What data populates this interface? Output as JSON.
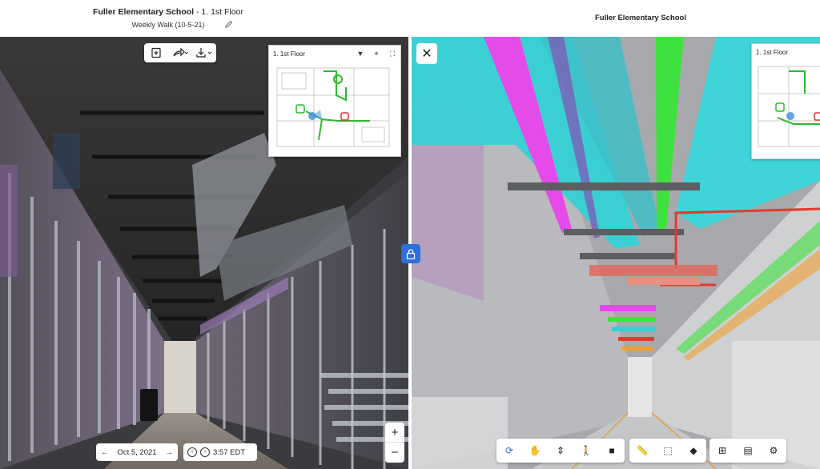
{
  "header": {
    "project": "Fuller Elementary School",
    "separator": " - ",
    "floor": "1. 1st Floor",
    "walk": "Weekly Walk (10-5-21)",
    "right_title": "Fuller Elementary School"
  },
  "minimap": {
    "left_label": "1. 1st Floor",
    "right_label": "1. 1st Floor"
  },
  "controls": {
    "date": "Oct 5, 2021",
    "time": "3:57 EDT",
    "zoom_in": "+",
    "zoom_out": "−",
    "close": "✕"
  },
  "icons": [
    "new-doc-icon",
    "share-icon",
    "download-icon",
    "chevron-down-icon",
    "crosshair-icon",
    "fullscreen-icon",
    "lock-icon",
    "close-icon",
    "orbit-icon",
    "pan-hand-icon",
    "vertical-move-icon",
    "person-walk-icon",
    "camera-icon",
    "measure-icon",
    "section-box-icon",
    "cube-explode-icon",
    "hierarchy-icon",
    "properties-icon",
    "settings-icon"
  ],
  "colors": {
    "accent": "#2f6fdb",
    "duct_cyan": "#2fd3d6",
    "duct_magenta": "#e44be8",
    "pipe_green": "#3ee23e",
    "pipe_red": "#e23a2a"
  }
}
